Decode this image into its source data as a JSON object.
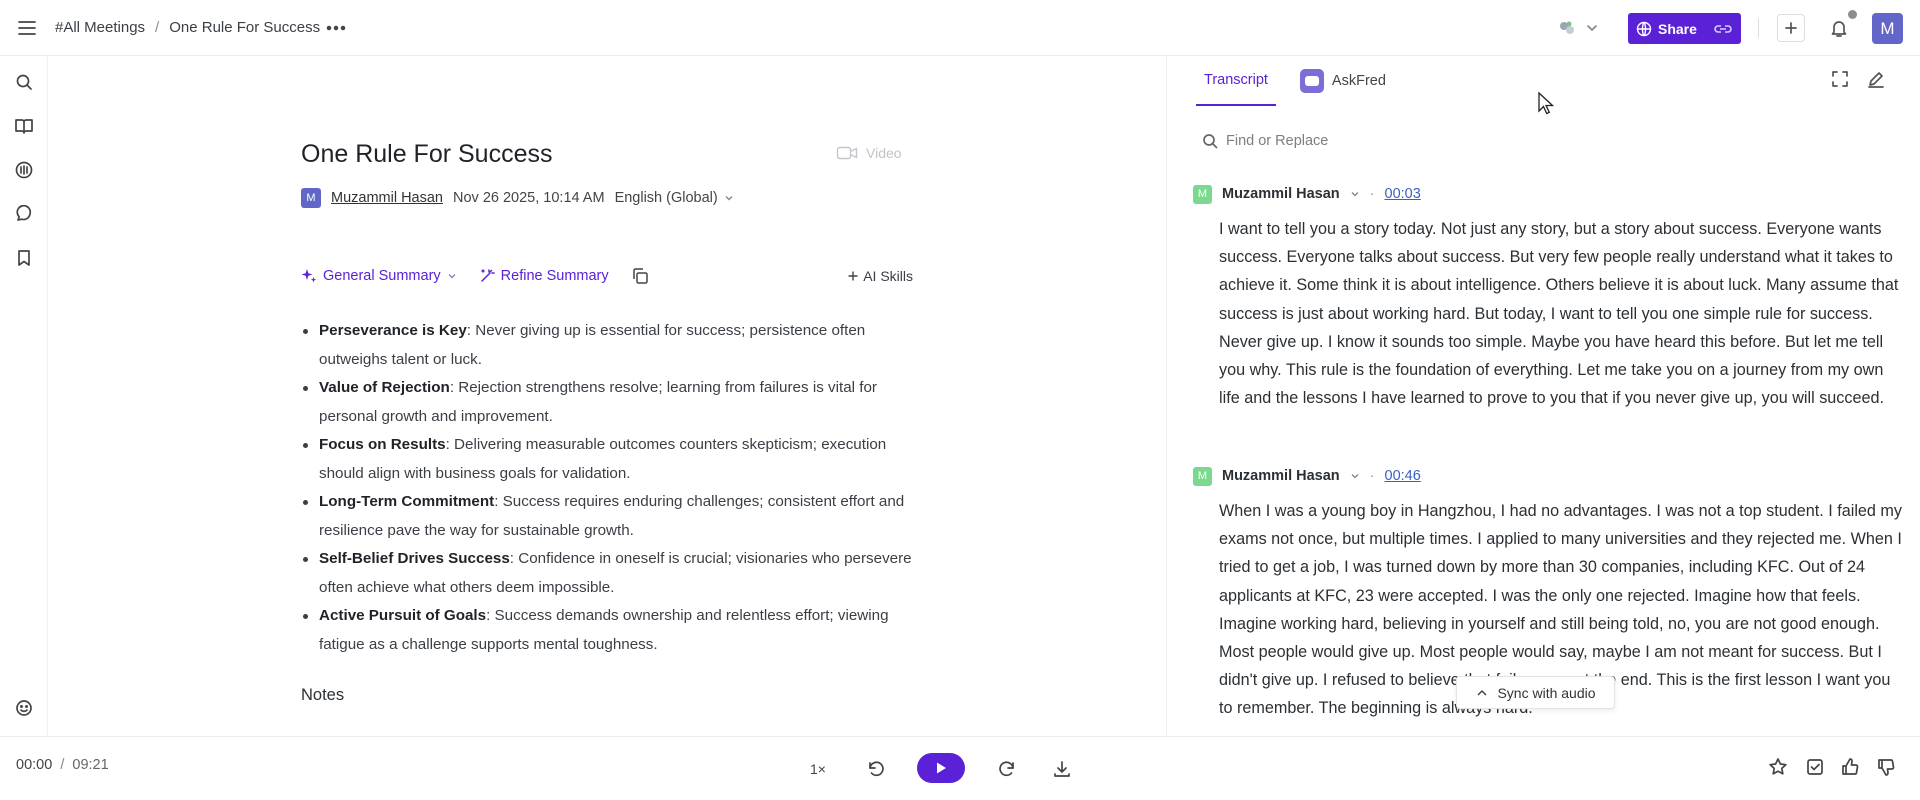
{
  "breadcrumb": {
    "root": "#All Meetings",
    "sep": "/",
    "current": "One Rule For Success"
  },
  "topbar": {
    "share_label": "Share",
    "avatar_initial": "M"
  },
  "meeting": {
    "title": "One Rule For Success",
    "video_label": "Video",
    "owner_initial": "M",
    "owner_name": "Muzammil Hasan",
    "date": "Nov 26 2025, 10:14 AM",
    "language": "English (Global)"
  },
  "summary_toolbar": {
    "general_summary": "General Summary",
    "refine_summary": "Refine Summary",
    "ai_skills": "AI Skills"
  },
  "bullets": [
    {
      "term": "Perseverance is Key",
      "text": ": Never giving up is essential for success; persistence often outweighs talent or luck."
    },
    {
      "term": "Value of Rejection",
      "text": ": Rejection strengthens resolve; learning from failures is vital for personal growth and improvement."
    },
    {
      "term": "Focus on Results",
      "text": ": Delivering measurable outcomes counters skepticism; execution should align with business goals for validation."
    },
    {
      "term": "Long-Term Commitment",
      "text": ": Success requires enduring challenges; consistent effort and resilience pave the way for sustainable growth."
    },
    {
      "term": "Self-Belief Drives Success",
      "text": ": Confidence in oneself is crucial; visionaries who persevere often achieve what others deem impossible."
    },
    {
      "term": "Active Pursuit of Goals",
      "text": ": Success demands ownership and relentless effort; viewing fatigue as a challenge supports mental toughness."
    }
  ],
  "notes_heading": "Notes",
  "panel": {
    "tab_transcript": "Transcript",
    "tab_askfred": "AskFred",
    "search_placeholder": "Find or Replace"
  },
  "transcript": [
    {
      "initial": "M",
      "speaker": "Muzammil Hasan",
      "time": "00:03",
      "text": "I want to tell you a story today. Not just any story, but a story about success. Everyone wants success. Everyone talks about success. But very few people really understand what it takes to achieve it. Some think it is about intelligence. Others believe it is about luck. Many assume that success is just about working hard. But today, I want to tell you one simple rule for success. Never give up. I know it sounds too simple. Maybe you have heard this before. But let me tell you why. This rule is the foundation of everything. Let me take you on a journey from my own life and the lessons I have learned to prove to you that if you never give up, you will succeed."
    },
    {
      "initial": "M",
      "speaker": "Muzammil Hasan",
      "time": "00:46",
      "text": "When I was a young boy in Hangzhou, I had no advantages. I was not a top student. I failed my exams not once, but multiple times. I applied to many universities and they rejected me. When I tried to get a job, I was turned down by more than 30 companies, including KFC. Out of 24 applicants at KFC, 23 were accepted. I was the only one rejected. Imagine how that feels. Imagine working hard, believing in yourself and still being told, no, you are not good enough. Most people would give up. Most people would say, maybe I am not meant for success. But I didn't give up. I refused to believe that failure meant the end. This is the first lesson I want you to remember. The beginning is always hard."
    }
  ],
  "sync_label": "Sync with audio",
  "player": {
    "current": "00:00",
    "sep": "/",
    "total": "09:21",
    "speed": "1×"
  },
  "colors": {
    "accent": "#5b21d6",
    "avatar": "#6366c9",
    "speaker_avatar": "#7bd88f"
  }
}
